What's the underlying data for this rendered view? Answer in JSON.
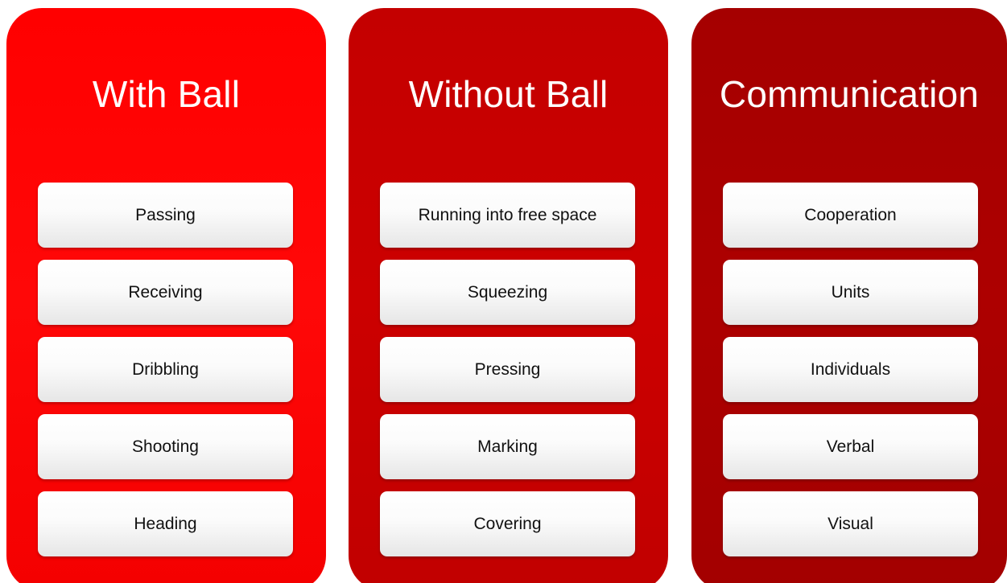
{
  "columns": [
    {
      "title": "With Ball",
      "items": [
        "Passing",
        "Receiving",
        "Dribbling",
        "Shooting",
        "Heading"
      ]
    },
    {
      "title": "Without Ball",
      "items": [
        "Running into free space",
        "Squeezing",
        "Pressing",
        "Marking",
        "Covering"
      ]
    },
    {
      "title": "Communication",
      "items": [
        "Cooperation",
        "Units",
        "Individuals",
        "Verbal",
        "Visual"
      ]
    }
  ],
  "colors": {
    "column_1": "#ff0000",
    "column_2": "#cc0000",
    "column_3": "#ad0000",
    "item_background": "#ffffff",
    "title_text": "#ffffff"
  }
}
